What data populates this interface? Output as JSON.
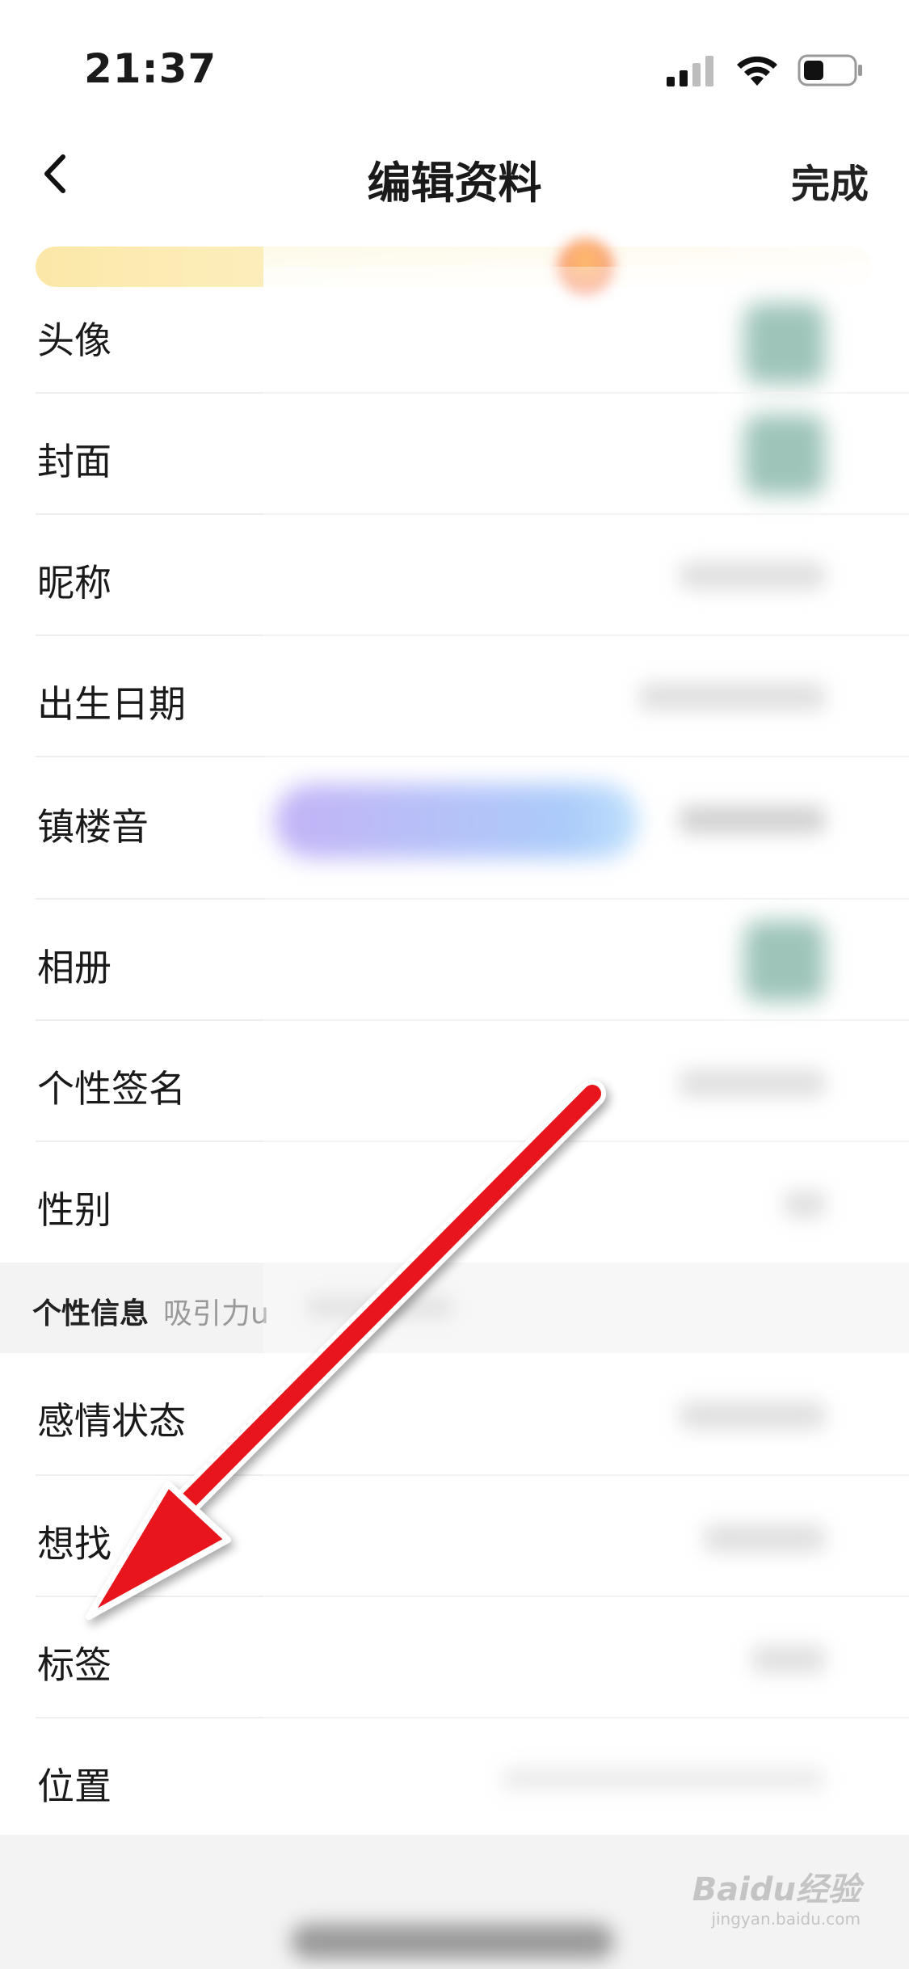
{
  "status_bar": {
    "time": "21:37"
  },
  "nav": {
    "title": "编辑资料",
    "done_label": "完成"
  },
  "rows": [
    {
      "label": "头像"
    },
    {
      "label": "封面"
    },
    {
      "label": "昵称"
    },
    {
      "label": "出生日期"
    },
    {
      "label": "镇楼音"
    },
    {
      "label": "相册"
    },
    {
      "label": "个性签名"
    },
    {
      "label": "性别"
    }
  ],
  "section": {
    "title": "个性信息",
    "subtitle": "吸引力u"
  },
  "rows2": [
    {
      "label": "感情状态"
    },
    {
      "label": "想找"
    },
    {
      "label": "标签"
    },
    {
      "label": "位置"
    }
  ],
  "watermark": {
    "text": "Baidu经验",
    "sub": "jingyan.baidu.com"
  },
  "colors": {
    "arrow": "#e8141b",
    "avatar_blur": "#6aa594",
    "banner": "#fbe8a8"
  }
}
